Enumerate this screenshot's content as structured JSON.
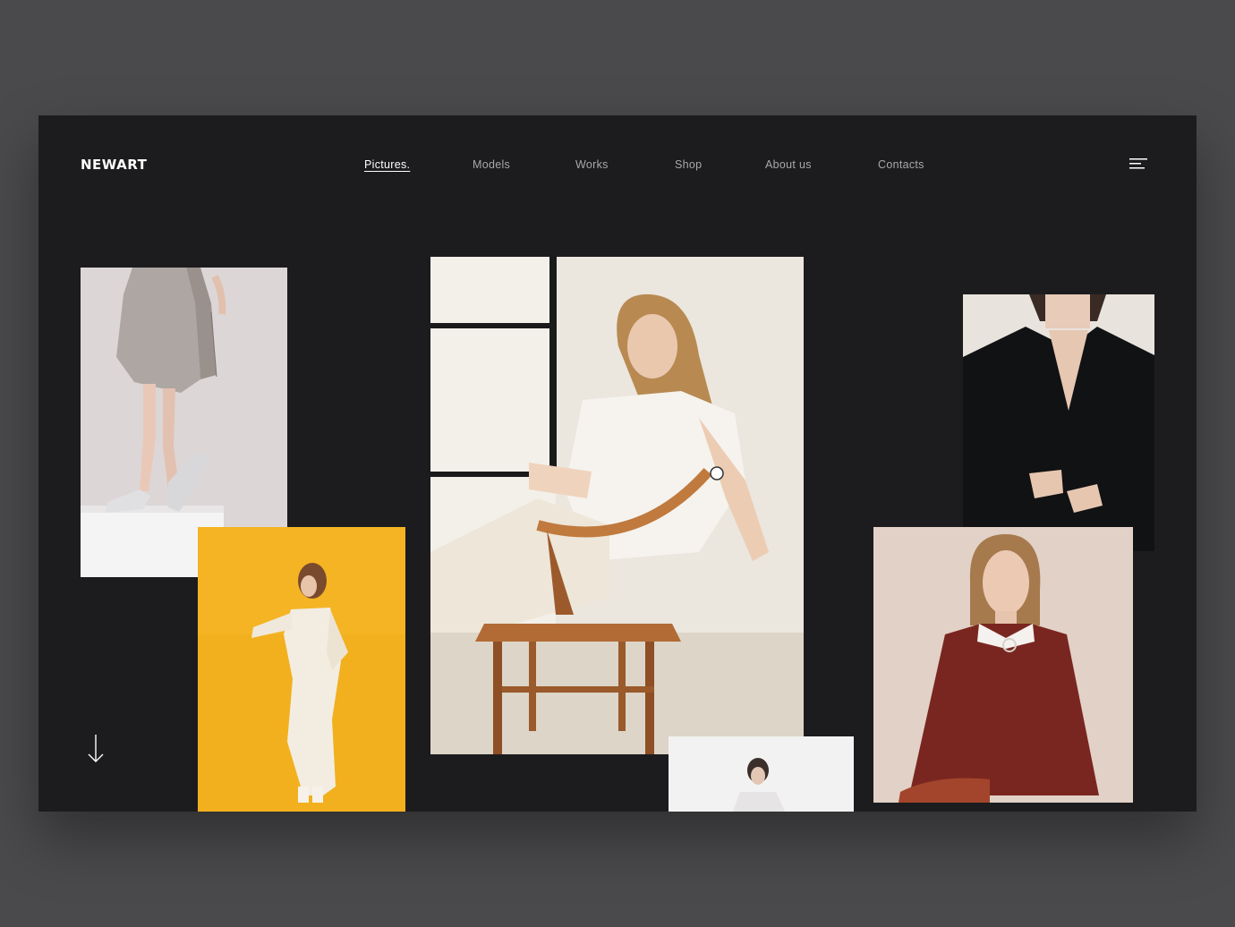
{
  "brand": {
    "name": "NEWART"
  },
  "nav": {
    "items": [
      {
        "label": "Pictures.",
        "active": true
      },
      {
        "label": "Models",
        "active": false
      },
      {
        "label": "Works",
        "active": false
      },
      {
        "label": "Shop",
        "active": false
      },
      {
        "label": "About us",
        "active": false
      },
      {
        "label": "Contacts",
        "active": false
      }
    ]
  },
  "icons": {
    "menu": "hamburger-menu-icon",
    "scroll": "arrow-down-icon"
  },
  "colors": {
    "page_bg": "#4a4a4c",
    "frame_bg": "#1c1c1e",
    "text_primary": "#ffffff",
    "text_muted": "#a8a8aa",
    "accent_yellow": "#f2b01e",
    "accent_rust": "#7a2620"
  }
}
